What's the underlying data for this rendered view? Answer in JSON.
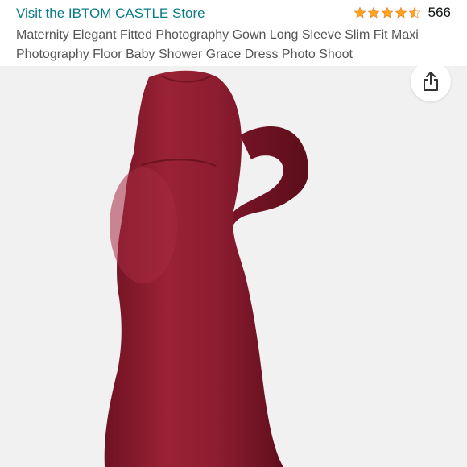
{
  "header": {
    "store_link": "Visit the IBTOM CASTLE Store",
    "rating": {
      "stars": 4.5,
      "star_color": "#ffa41c",
      "count": "566"
    },
    "title": "Maternity Elegant Fitted Photography Gown Long Sleeve Slim Fit Maxi Photography Floor Baby Shower Grace Dress Photo Shoot"
  },
  "image": {
    "background": "#f2f1f1",
    "subject": "burgundy-long-sleeve-maternity-maxi-dress",
    "dress_color": "#8c1d2e"
  },
  "actions": {
    "share_icon": "share-icon"
  }
}
